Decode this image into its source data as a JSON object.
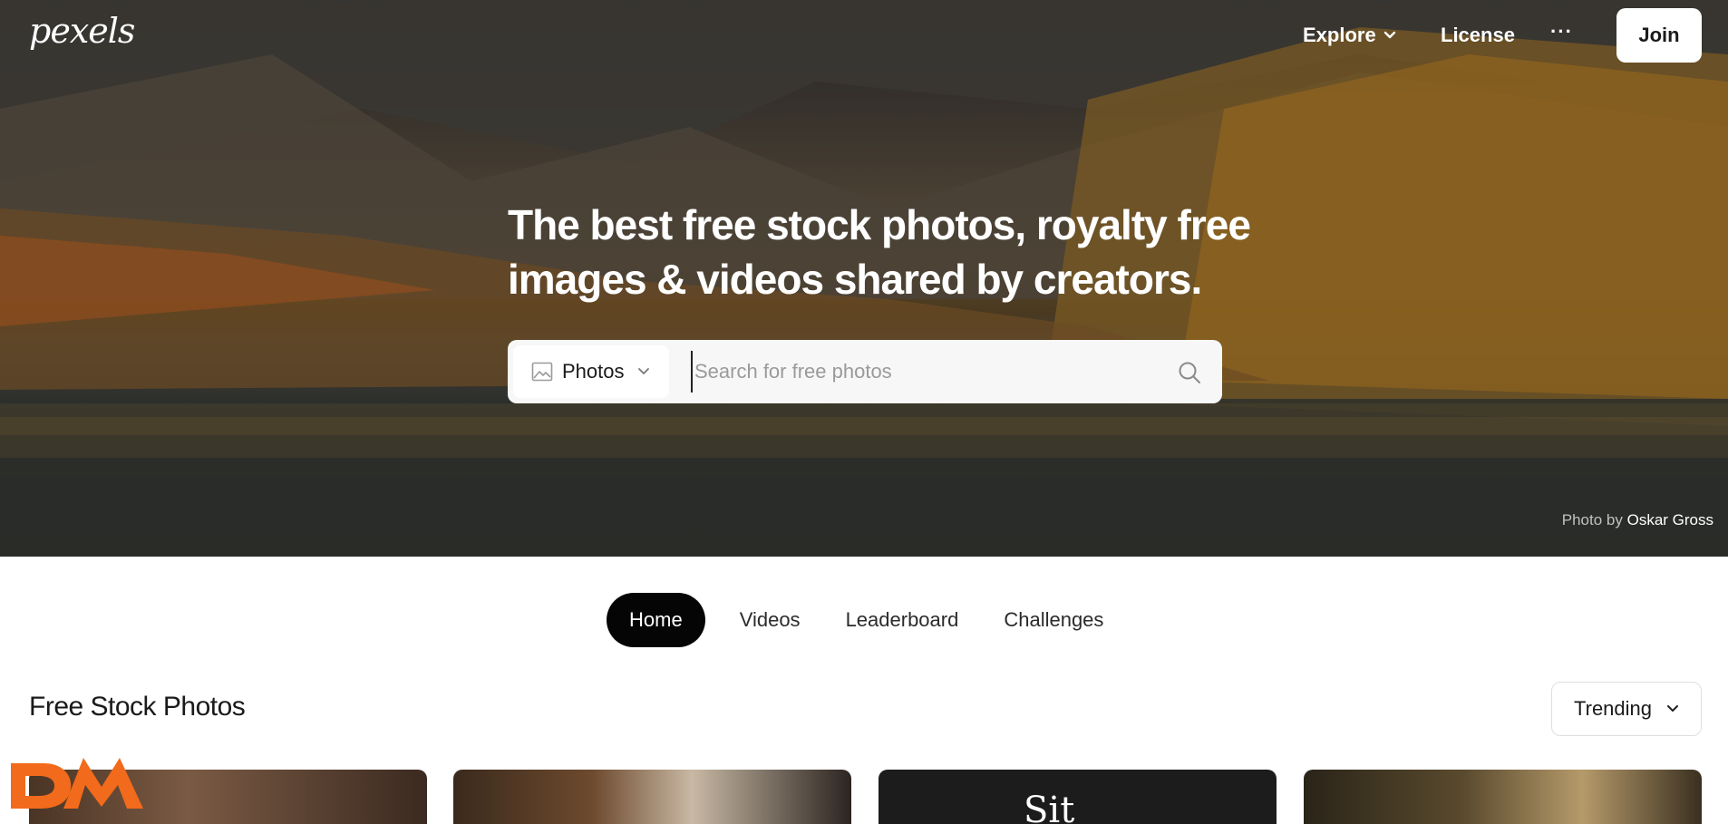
{
  "topbar": {
    "logo": "pexels",
    "explore": "Explore",
    "license": "License",
    "more": "···",
    "join": "Join"
  },
  "hero": {
    "headline_line1": "The best free stock photos, royalty free",
    "headline_line2": "images & videos shared by creators.",
    "search": {
      "type_label": "Photos",
      "placeholder": "Search for free photos"
    },
    "credit_prefix": "Photo by",
    "credit_author": "Oskar Gross"
  },
  "tabs": [
    {
      "label": "Home",
      "active": true
    },
    {
      "label": "Videos",
      "active": false
    },
    {
      "label": "Leaderboard",
      "active": false
    },
    {
      "label": "Challenges",
      "active": false
    }
  ],
  "section": {
    "title": "Free Stock Photos",
    "sort_label": "Trending"
  },
  "thumbs": {
    "third_text": "Sit"
  },
  "badge": {
    "text": "DM",
    "color": "#f26a1b"
  },
  "colors": {
    "active_tab_bg": "#050505",
    "hero_text": "#ffffff"
  }
}
